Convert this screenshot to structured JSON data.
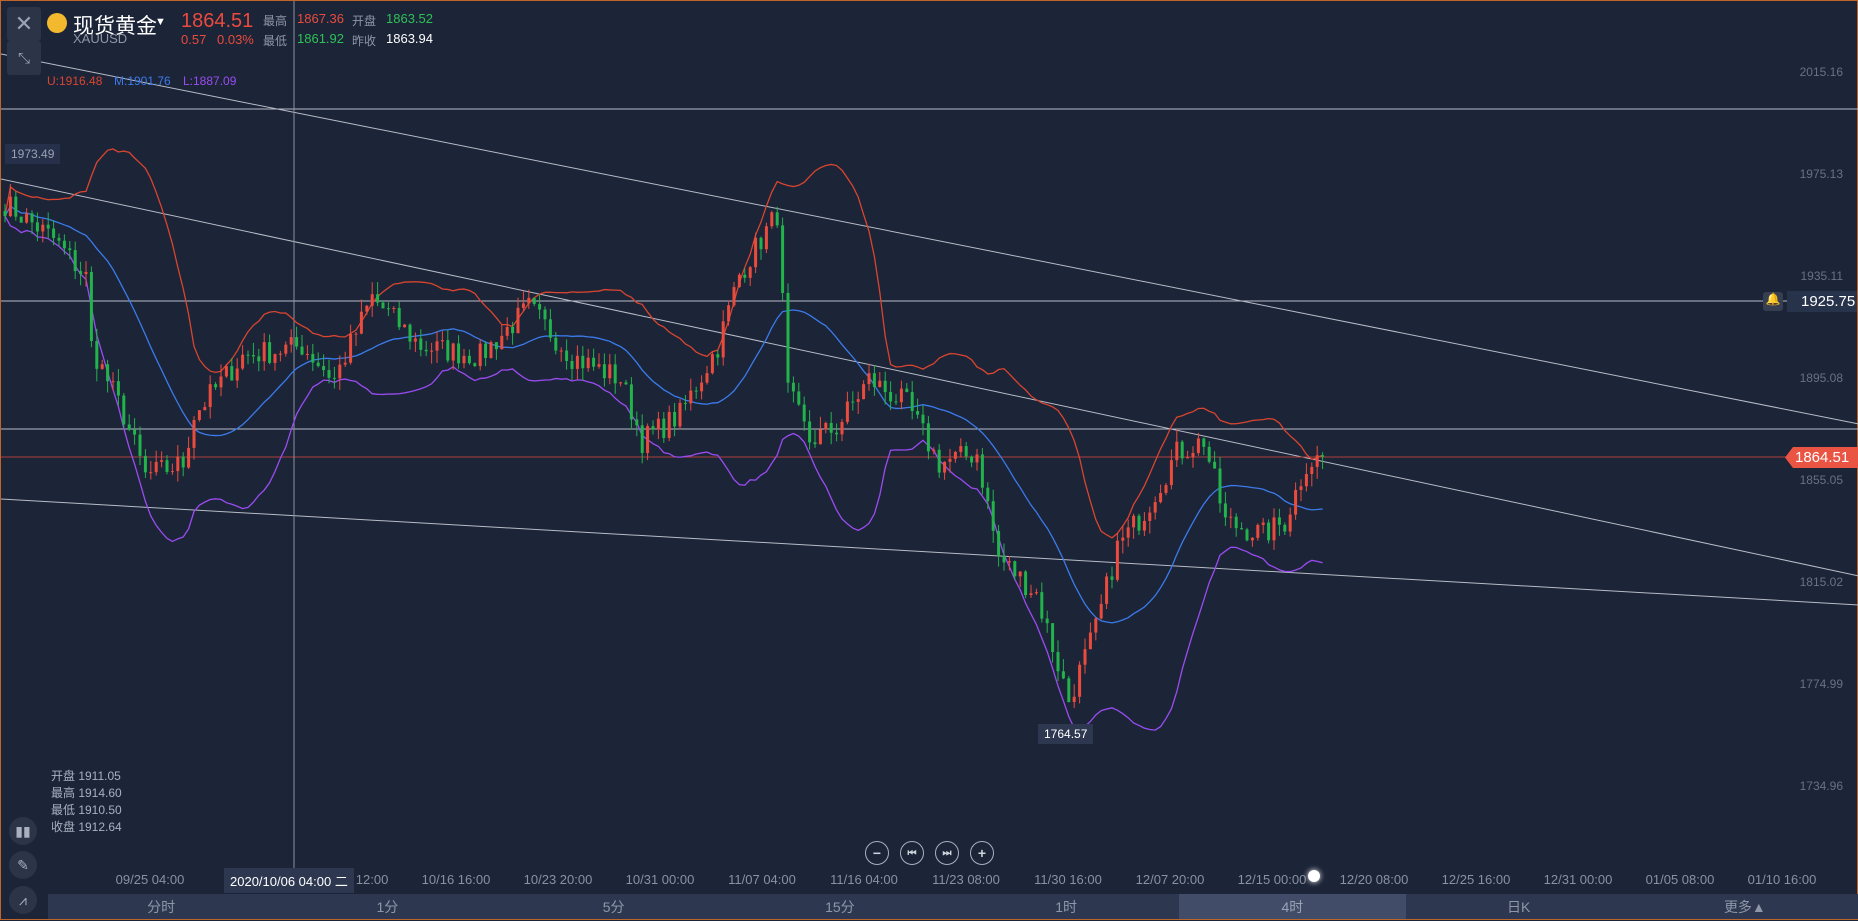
{
  "header": {
    "symbol_name": "现货黄金",
    "symbol_code": "XAUUSD",
    "price": "1864.51",
    "change": "0.57",
    "change_pct": "0.03%",
    "high_label": "最高",
    "high": "1867.36",
    "open_label": "开盘",
    "open": "1863.52",
    "low_label": "最低",
    "low": "1861.92",
    "prev_close_label": "昨收",
    "prev_close": "1863.94"
  },
  "indicator": {
    "upper": "U:1916.48",
    "middle": "M:1901.76",
    "lower": "L:1887.09"
  },
  "y_axis": [
    "2015.16",
    "1975.13",
    "1935.11",
    "1895.08",
    "1855.05",
    "1815.02",
    "1774.99",
    "1734.96"
  ],
  "price_tags": {
    "current": "1864.51",
    "alert_line": "1925.75",
    "crosshair_price": "1973.49",
    "period_low": "1764.57"
  },
  "x_axis": [
    [
      "09/25 04:00",
      0
    ],
    [
      "10/09 12:00",
      2
    ],
    [
      "10/16 16:00",
      3
    ],
    [
      "10/23 20:00",
      4
    ],
    [
      "10/31 00:00",
      5
    ],
    [
      "11/07 04:00",
      6
    ],
    [
      "11/16 04:00",
      7
    ],
    [
      "11/23 08:00",
      8
    ],
    [
      "11/30 16:00",
      9
    ],
    [
      "12/07 20:00",
      10
    ],
    [
      "12/15 00:00",
      11
    ],
    [
      "12/20 08:00",
      12
    ],
    [
      "12/25 16:00",
      13
    ],
    [
      "12/31 00:00",
      14
    ],
    [
      "01/05 08:00",
      15
    ],
    [
      "01/10 16:00",
      16
    ]
  ],
  "crosshair_time": "2020/10/06 04:00 二",
  "ohlc_tooltip": [
    [
      "开盘",
      "1911.05"
    ],
    [
      "最高",
      "1914.60"
    ],
    [
      "最低",
      "1910.50"
    ],
    [
      "收盘",
      "1912.64"
    ]
  ],
  "tabs": [
    {
      "label": "分时"
    },
    {
      "label": "1分"
    },
    {
      "label": "5分"
    },
    {
      "label": "15分"
    },
    {
      "label": "1时"
    },
    {
      "label": "4时",
      "active": true
    },
    {
      "label": "日K"
    },
    {
      "label": "更多▲"
    }
  ],
  "colors": {
    "up": "#ea4b3d",
    "down": "#22b34b",
    "upper": "#d9452f",
    "middle": "#3b7bea",
    "lower": "#9a4cf0"
  },
  "chart_data": {
    "type": "candlestick",
    "y_range": [
      1734.96,
      2015.16
    ],
    "close_keypoints": [
      [
        0,
        1964
      ],
      [
        9,
        1950
      ],
      [
        15,
        1935
      ],
      [
        16,
        1908
      ],
      [
        22,
        1881
      ],
      [
        26,
        1857
      ],
      [
        33,
        1862
      ],
      [
        35,
        1881
      ],
      [
        44,
        1904
      ],
      [
        55,
        1908
      ],
      [
        61,
        1895
      ],
      [
        68,
        1927
      ],
      [
        77,
        1908
      ],
      [
        88,
        1904
      ],
      [
        97,
        1923
      ],
      [
        105,
        1904
      ],
      [
        114,
        1895
      ],
      [
        118,
        1871
      ],
      [
        125,
        1881
      ],
      [
        132,
        1908
      ],
      [
        136,
        1936
      ],
      [
        143,
        1960
      ],
      [
        145,
        1890
      ],
      [
        149,
        1871
      ],
      [
        154,
        1876
      ],
      [
        160,
        1895
      ],
      [
        167,
        1885
      ],
      [
        173,
        1862
      ],
      [
        180,
        1866
      ],
      [
        184,
        1825
      ],
      [
        191,
        1811
      ],
      [
        197,
        1769
      ],
      [
        202,
        1797
      ],
      [
        206,
        1829
      ],
      [
        211,
        1843
      ],
      [
        217,
        1866
      ],
      [
        222,
        1871
      ],
      [
        226,
        1839
      ],
      [
        233,
        1834
      ],
      [
        237,
        1839
      ],
      [
        241,
        1862
      ],
      [
        244,
        1864.51
      ]
    ],
    "bollinger_period": 20
  }
}
